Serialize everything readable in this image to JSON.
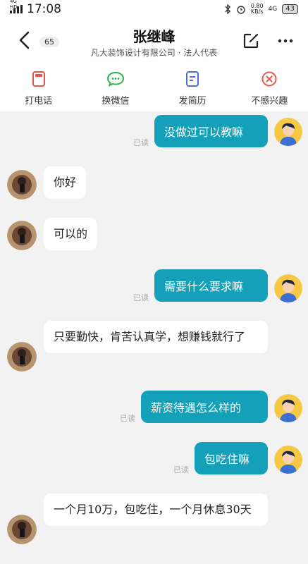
{
  "status_bar": {
    "network": "4G HD",
    "time": "17:08",
    "speed_value": "0.80",
    "speed_unit": "KB/s",
    "net_type": "4G",
    "battery": "43"
  },
  "header": {
    "unread_count": "65",
    "contact_name": "张继峰",
    "contact_subtitle": "凡大装饰设计有限公司 · 法人代表"
  },
  "actions": [
    {
      "label": "打电话",
      "icon": "phone-icon"
    },
    {
      "label": "换微信",
      "icon": "wechat-icon"
    },
    {
      "label": "发简历",
      "icon": "resume-icon"
    },
    {
      "label": "不感兴趣",
      "icon": "not-interested-icon"
    }
  ],
  "colors": {
    "accent": "#13a0b8",
    "background": "#f2f2f2",
    "not_interested": "#e8534a",
    "resume": "#4a6ed8",
    "wechat": "#2bb24c",
    "phone": "#e8534a"
  },
  "messages": [
    {
      "side": "right",
      "text": "没做过可以教嘛",
      "status": "已读"
    },
    {
      "side": "left",
      "text": "你好"
    },
    {
      "side": "left",
      "text": "可以的"
    },
    {
      "side": "right",
      "text": "需要什么要求嘛",
      "status": "已读"
    },
    {
      "side": "left",
      "text": "只要勤快，肯苦认真学，想赚钱就行了"
    },
    {
      "side": "right",
      "text": "薪资待遇怎么样的",
      "status": "已读"
    },
    {
      "side": "right",
      "text": "包吃住嘛",
      "status": "已读"
    },
    {
      "side": "left",
      "text": "一个月10万，包吃住，一个月休息30天"
    }
  ]
}
